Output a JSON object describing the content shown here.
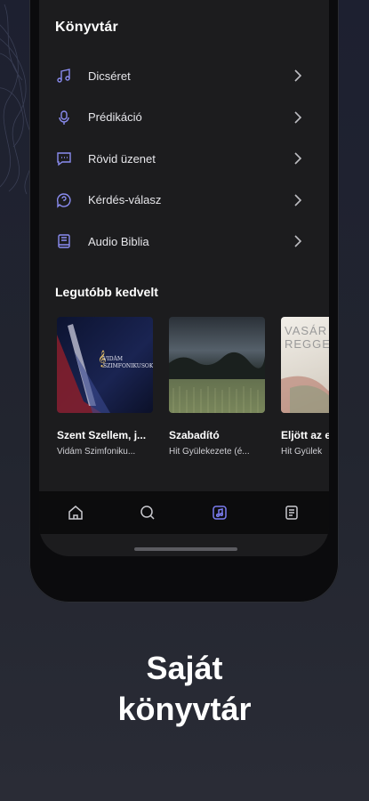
{
  "library": {
    "title": "Könyvtár",
    "items": [
      {
        "label": "Dicséret",
        "icon": "music-note-icon"
      },
      {
        "label": "Prédikáció",
        "icon": "microphone-icon"
      },
      {
        "label": "Rövid üzenet",
        "icon": "message-icon"
      },
      {
        "label": "Kérdés-válasz",
        "icon": "question-chat-icon"
      },
      {
        "label": "Audio Biblia",
        "icon": "book-icon"
      }
    ]
  },
  "recent": {
    "title": "Legutóbb kedvelt",
    "cards": [
      {
        "title": "Szent Szellem, j...",
        "subtitle": "Vidám Szimfoniku...",
        "cover_text": "VIDÁM SZIMFONIKUSOK"
      },
      {
        "title": "Szabadító",
        "subtitle": "Hit Gyülekezete (é...",
        "cover_text": ""
      },
      {
        "title": "Eljött az e",
        "subtitle": "Hit Gyülek",
        "cover_text": "VASÁR REGGE"
      }
    ]
  },
  "nav": {
    "items": [
      {
        "name": "home-icon"
      },
      {
        "name": "search-icon"
      },
      {
        "name": "library-icon",
        "active": true
      },
      {
        "name": "notes-icon"
      }
    ],
    "active_color": "#7b7df0"
  },
  "caption": {
    "line1": "Saját",
    "line2": "könyvtár"
  },
  "colors": {
    "accent": "#8a8cf0",
    "screen_bg": "#1c1c1e",
    "page_bg": "#1f2230"
  }
}
